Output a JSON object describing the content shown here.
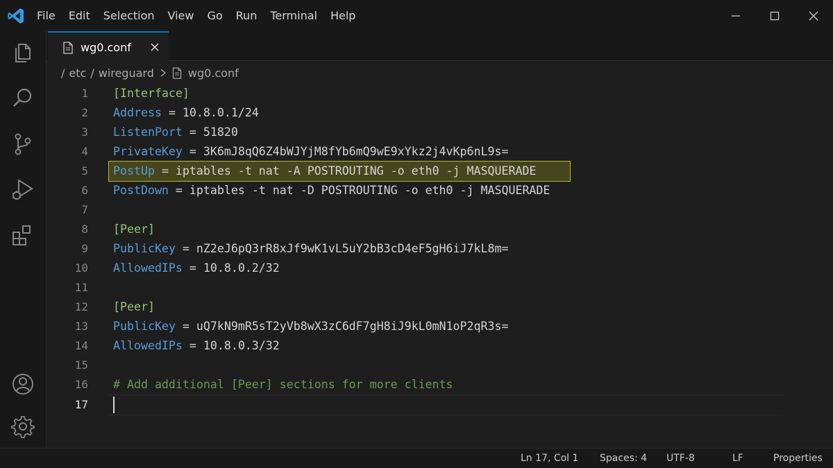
{
  "menu": {
    "items": [
      "File",
      "Edit",
      "Selection",
      "View",
      "Go",
      "Run",
      "Terminal",
      "Help"
    ]
  },
  "tab": {
    "label": "wg0.conf"
  },
  "breadcrumb": {
    "parts": [
      "/",
      "etc",
      "/",
      "wireguard",
      "wg0.conf"
    ]
  },
  "editor": {
    "lines": [
      {
        "num": "1",
        "key": "",
        "rest": "",
        "section": "[Interface]",
        "comment": ""
      },
      {
        "num": "2",
        "key": "Address",
        "rest": " = 10.8.0.1/24",
        "section": "",
        "comment": ""
      },
      {
        "num": "3",
        "key": "ListenPort",
        "rest": " = 51820",
        "section": "",
        "comment": ""
      },
      {
        "num": "4",
        "key": "PrivateKey",
        "rest": " = 3K6mJ8qQ6Z4bWJYjM8fYb6mQ9wE9xYkz2j4vKp6nL9s=",
        "section": "",
        "comment": ""
      },
      {
        "num": "5",
        "key": "PostUp",
        "rest": " = iptables -t nat -A POSTROUTING -o eth0 -j MASQUERADE",
        "section": "",
        "comment": ""
      },
      {
        "num": "6",
        "key": "PostDown",
        "rest": " = iptables -t nat -D POSTROUTING -o eth0 -j MASQUERADE",
        "section": "",
        "comment": ""
      },
      {
        "num": "7",
        "key": "",
        "rest": "",
        "section": "",
        "comment": ""
      },
      {
        "num": "8",
        "key": "",
        "rest": "",
        "section": "[Peer]",
        "comment": ""
      },
      {
        "num": "9",
        "key": "PublicKey",
        "rest": " = nZ2eJ6pQ3rR8xJf9wK1vL5uY2bB3cD4eF5gH6iJ7kL8m=",
        "section": "",
        "comment": ""
      },
      {
        "num": "10",
        "key": "AllowedIPs",
        "rest": " = 10.8.0.2/32",
        "section": "",
        "comment": ""
      },
      {
        "num": "11",
        "key": "",
        "rest": "",
        "section": "",
        "comment": ""
      },
      {
        "num": "12",
        "key": "",
        "rest": "",
        "section": "[Peer]",
        "comment": ""
      },
      {
        "num": "13",
        "key": "PublicKey",
        "rest": " = uQ7kN9mR5sT2yVb8wX3zC6dF7gH8iJ9kL0mN1oP2qR3s=",
        "section": "",
        "comment": ""
      },
      {
        "num": "14",
        "key": "AllowedIPs",
        "rest": " = 10.8.0.3/32",
        "section": "",
        "comment": ""
      },
      {
        "num": "15",
        "key": "",
        "rest": "",
        "section": "",
        "comment": ""
      },
      {
        "num": "16",
        "key": "",
        "rest": "",
        "section": "",
        "comment": "# Add additional [Peer] sections for more clients"
      },
      {
        "num": "17",
        "key": "",
        "rest": "",
        "section": "",
        "comment": ""
      }
    ]
  },
  "status": {
    "position": "Ln 17, Col 1",
    "spaces": "Spaces: 4",
    "encoding": "UTF-8",
    "eol": "LF",
    "properties": "Properties"
  },
  "colors": {
    "accent": "#0078d4",
    "key": "#569cd6",
    "section": "#98c379",
    "comment": "#6a9955",
    "highlight_border": "#b8b841"
  }
}
